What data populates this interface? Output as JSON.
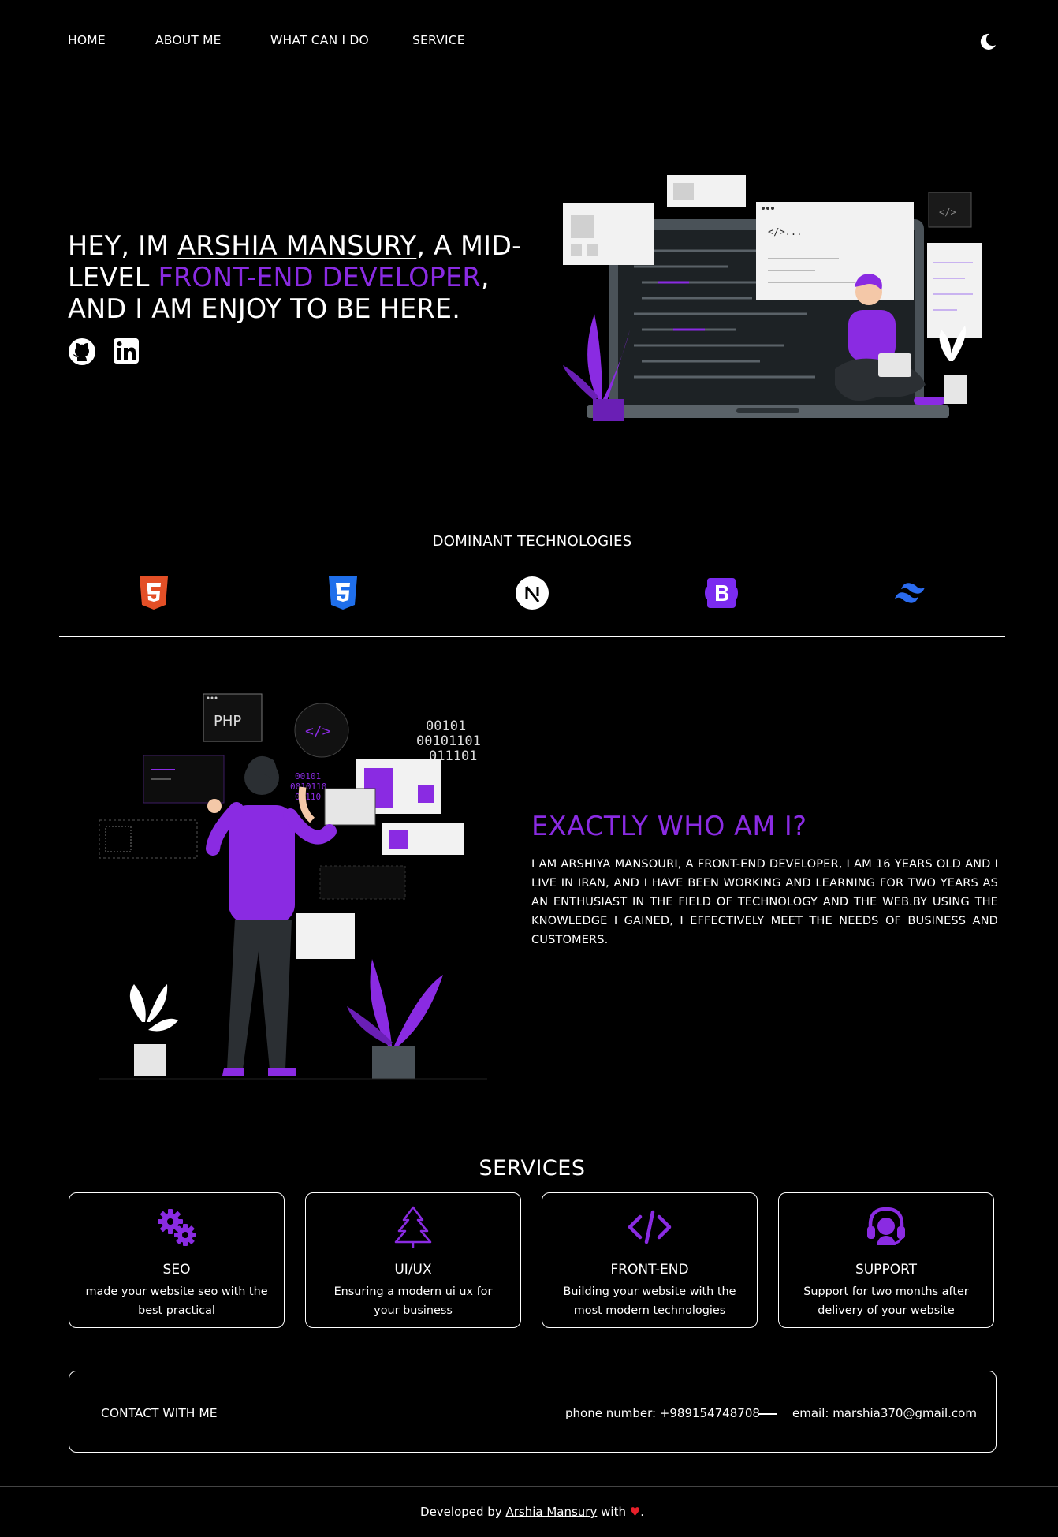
{
  "nav": {
    "items": [
      "HOME",
      "ABOUT ME",
      "WHAT CAN I DO",
      "SERVICE"
    ],
    "theme_icon": "moon-icon"
  },
  "hero": {
    "line1_prefix": "HEY, IM ",
    "name": "ARSHIA MANSURY",
    "line1_suffix": ", A MID-",
    "line2_prefix": "LEVEL ",
    "role": "FRONT-END DEVELOPER",
    "line2_suffix": ",",
    "line3": "AND I AM ENJOY TO BE HERE.",
    "socials": [
      "github-icon",
      "linkedin-icon"
    ],
    "illustration": "developer-with-laptop-illustration"
  },
  "technologies": {
    "title": "DOMINANT TECHNOLOGIES",
    "icons": [
      "html5-icon",
      "css3-icon",
      "nextjs-icon",
      "bootstrap-icon",
      "tailwind-icon"
    ]
  },
  "about": {
    "title": "EXACTLY WHO AM I?",
    "text": "I AM ARSHIYA MANSOURI, A FRONT-END DEVELOPER, I AM 16 YEARS OLD AND I LIVE IN IRAN, AND I HAVE BEEN WORKING AND LEARNING FOR TWO YEARS AS AN ENTHUSIAST IN THE FIELD OF TECHNOLOGY AND THE WEB.BY USING THE KNOWLEDGE I GAINED, I EFFECTIVELY MEET THE NEEDS OF BUSINESS AND CUSTOMERS.",
    "illustration": "developer-standing-illustration",
    "illustration_text": {
      "php": "PHP",
      "binary1": "00101",
      "binary2": "00101101",
      "binary3": "011101",
      "binary_small1": "00101",
      "binary_small2": "0010110",
      "binary_small3": "01110"
    }
  },
  "services": {
    "title": "SERVICES",
    "cards": [
      {
        "title": "SEO",
        "desc": "made your website seo with the best practical",
        "icon": "gears-icon"
      },
      {
        "title": "UI/UX",
        "desc": "Ensuring a modern ui ux for your business",
        "icon": "tree-icon"
      },
      {
        "title": "FRONT-END",
        "desc": "Building your website with the most modern technologies",
        "icon": "code-icon"
      },
      {
        "title": "SUPPORT",
        "desc": "Support for two months after delivery of your website",
        "icon": "headset-icon"
      }
    ]
  },
  "contact": {
    "label": "CONTACT WITH ME",
    "phone": "phone number: +989154748708",
    "email": "email: marshia370@gmail.com"
  },
  "footer": {
    "prefix": "Developed by ",
    "author": "Arshia Mansury",
    "middle": " with ",
    "heart": "♥",
    "suffix": "."
  },
  "colors": {
    "accent": "#8a2be2",
    "background": "#000000",
    "text": "#ffffff",
    "html5": "#e34f26",
    "css3": "#1f6feb",
    "bootstrap": "#7b2bf0",
    "tailwind": "#2b6cf0",
    "heart": "#e8202a"
  }
}
